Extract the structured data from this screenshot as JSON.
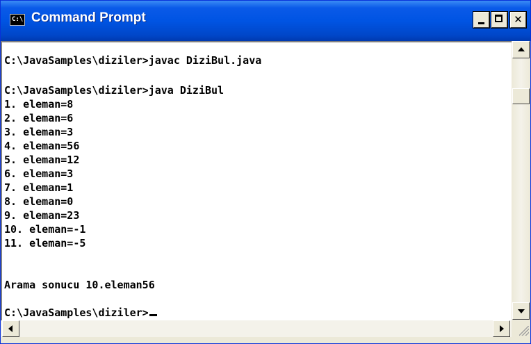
{
  "window": {
    "title": "Command Prompt",
    "icon_text": "C:\\",
    "icon": "console-icon",
    "controls": {
      "minimize": "minimize-icon",
      "maximize": "maximize-icon",
      "close": "close-icon",
      "close_glyph": "✕"
    }
  },
  "console": {
    "lines": [
      "",
      "C:\\JavaSamples\\diziler>javac DiziBul.java",
      "",
      "C:\\JavaSamples\\diziler>java DiziBul",
      "1. eleman=8",
      "2. eleman=6",
      "3. eleman=3",
      "4. eleman=56",
      "5. eleman=12",
      "6. eleman=3",
      "7. eleman=1",
      "8. eleman=0",
      "9. eleman=23",
      "10. eleman=-1",
      "11. eleman=-5",
      "",
      "Arama sonucu 10.eleman56",
      "",
      "C:\\JavaSamples\\diziler>"
    ],
    "foreground": "#000000",
    "background": "#ffffff"
  },
  "scrollbars": {
    "vertical": {
      "up": "scroll-up-arrow-icon",
      "down": "scroll-down-arrow-icon"
    },
    "horizontal": {
      "left": "scroll-left-arrow-icon",
      "right": "scroll-right-arrow-icon"
    }
  },
  "colors": {
    "titlebar": "#0054e3",
    "chrome": "#ece9d8"
  }
}
